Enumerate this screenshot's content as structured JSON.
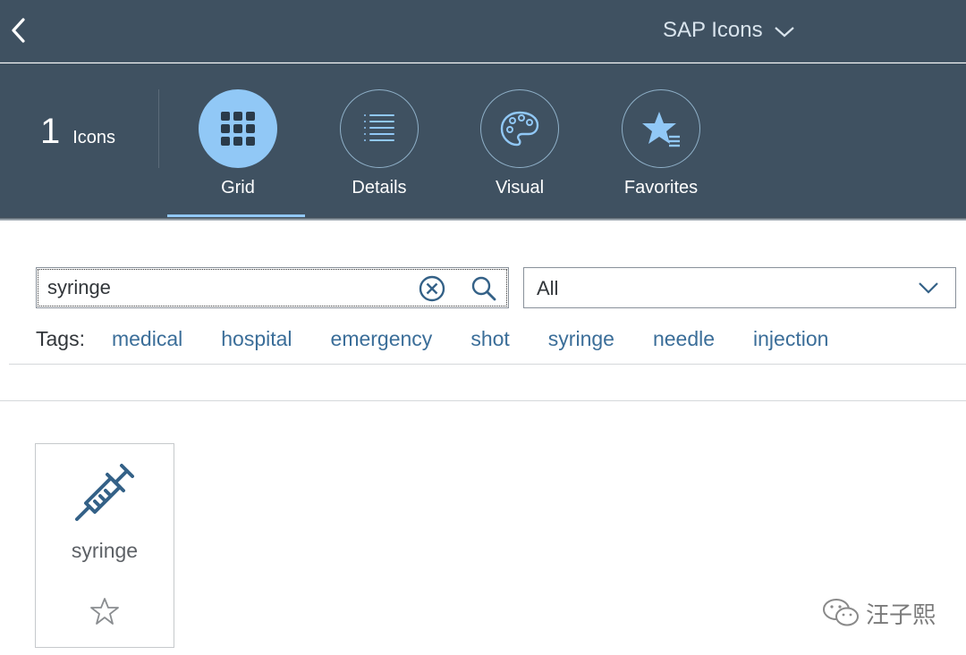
{
  "shell": {
    "title": "SAP Icons"
  },
  "header": {
    "count": "1",
    "count_label": "Icons",
    "tabs": [
      {
        "label": "Grid",
        "icon": "grid-icon",
        "active": true
      },
      {
        "label": "Details",
        "icon": "list-icon",
        "active": false
      },
      {
        "label": "Visual",
        "icon": "palette-icon",
        "active": false
      },
      {
        "label": "Favorites",
        "icon": "favorites-icon",
        "active": false
      }
    ]
  },
  "search": {
    "value": "syringe",
    "category": "All"
  },
  "tags": {
    "label": "Tags:",
    "items": [
      "medical",
      "hospital",
      "emergency",
      "shot",
      "syringe",
      "needle",
      "injection"
    ]
  },
  "results": [
    {
      "name": "syringe",
      "icon": "syringe-icon",
      "favorite": false
    }
  ],
  "watermark": {
    "text": "汪子熙"
  },
  "colors": {
    "shell_bg": "#3f5161",
    "accent": "#91c8f6",
    "link": "#3b6e99",
    "icon": "#346187"
  }
}
